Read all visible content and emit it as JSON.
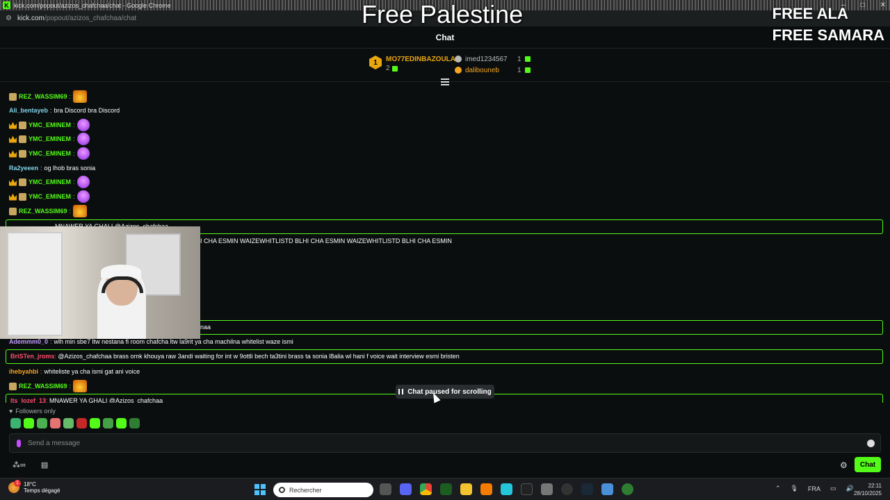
{
  "browser": {
    "window_title": "kick.com/popout/azizos_chafchaa/chat - Google Chrome",
    "url_host": "kick.com",
    "url_path": "/popout/azizos_chafchaa/chat"
  },
  "overlay": {
    "center_text": "Free Palestine",
    "right_line1": "FREE ALA",
    "right_line2": "FREE SAMARA"
  },
  "chat": {
    "header_title": "Chat",
    "leaderboard": {
      "first": {
        "rank": "1",
        "name": "MO77EDINBAZOULA",
        "count": "2"
      },
      "others": [
        {
          "name": "imed1234567",
          "count": "1",
          "color": "#bbbbbb"
        },
        {
          "name": "dalibouneb",
          "count": "1",
          "color": "#f5a623"
        }
      ]
    },
    "messages": [
      {
        "user": "REZ_WASSIM69",
        "sep": ":",
        "text": "",
        "color": "#53fc18"
      },
      {
        "user": "Ali_bentayeb",
        "sep": ":",
        "text": "bra Discord bra Discord",
        "color": "#7fd3e8"
      },
      {
        "user": "YMC_EMINEM",
        "sep": ":",
        "text": "",
        "color": "#53fc18"
      },
      {
        "user": "YMC_EMINEM",
        "sep": ":",
        "text": "",
        "color": "#53fc18"
      },
      {
        "user": "YMC_EMINEM",
        "sep": ":",
        "text": "",
        "color": "#53fc18"
      },
      {
        "user": "Ra2yeeen",
        "sep": ":",
        "text": "og lhob bras sonia",
        "color": "#7fd3e8"
      },
      {
        "user": "YMC_EMINEM",
        "sep": ":",
        "text": "",
        "color": "#53fc18"
      },
      {
        "user": "YMC_EMINEM",
        "sep": ":",
        "text": "",
        "color": "#53fc18"
      },
      {
        "user": "REZ_WASSIM69",
        "sep": ":",
        "text": "",
        "color": "#53fc18"
      }
    ],
    "partial_lines": {
      "hl1": "MNAWER YA GHALI @Azizos_chafchaa",
      "spam": "I CHA ESMIN WAIZEWHITLISTD BLHI CHA ESMIN WAIZEWHITLISTD BLHI CHA ESMIN",
      "hl2_tail": "naa"
    },
    "lower_messages": [
      {
        "user": "Ademmm0_0",
        "text": "wlh min sbe7 ltw nestana fi room chafcha ltw la9rit ya cha machilna whitelist waze ismi",
        "color": "#c39bff"
      },
      {
        "user": "BriSTen_jroms",
        "text": "@Azizos_chafchaa brass omk khouya raw 3andi waiting for int w 9ottli bech ta3tini brass ta sonia l8alia wl hani f voice wait interview esmi bristen",
        "color": "#ff4d6d"
      },
      {
        "user": "ihebyahbi",
        "text": "whiteliste ya cha ismi gat ani voice",
        "color": "#f5a623"
      },
      {
        "user": "REZ_WASSIM69",
        "text": "",
        "color": "#53fc18"
      },
      {
        "user": "lts_lozef_13",
        "text": "MNAWER YA GHALI @Azizos_chafchaa",
        "color": "#ff4d6d"
      }
    ],
    "paused_label": "Chat paused for scrolling",
    "followers_only": "Followers only",
    "input_placeholder": "Send a message",
    "chat_button": "Chat"
  },
  "taskbar": {
    "temperature": "18°C",
    "weather_desc": "Temps dégagé",
    "weather_badge": "1",
    "search_placeholder": "Rechercher",
    "language": "FRA",
    "time": "22:11",
    "date": "28/10/2025"
  }
}
